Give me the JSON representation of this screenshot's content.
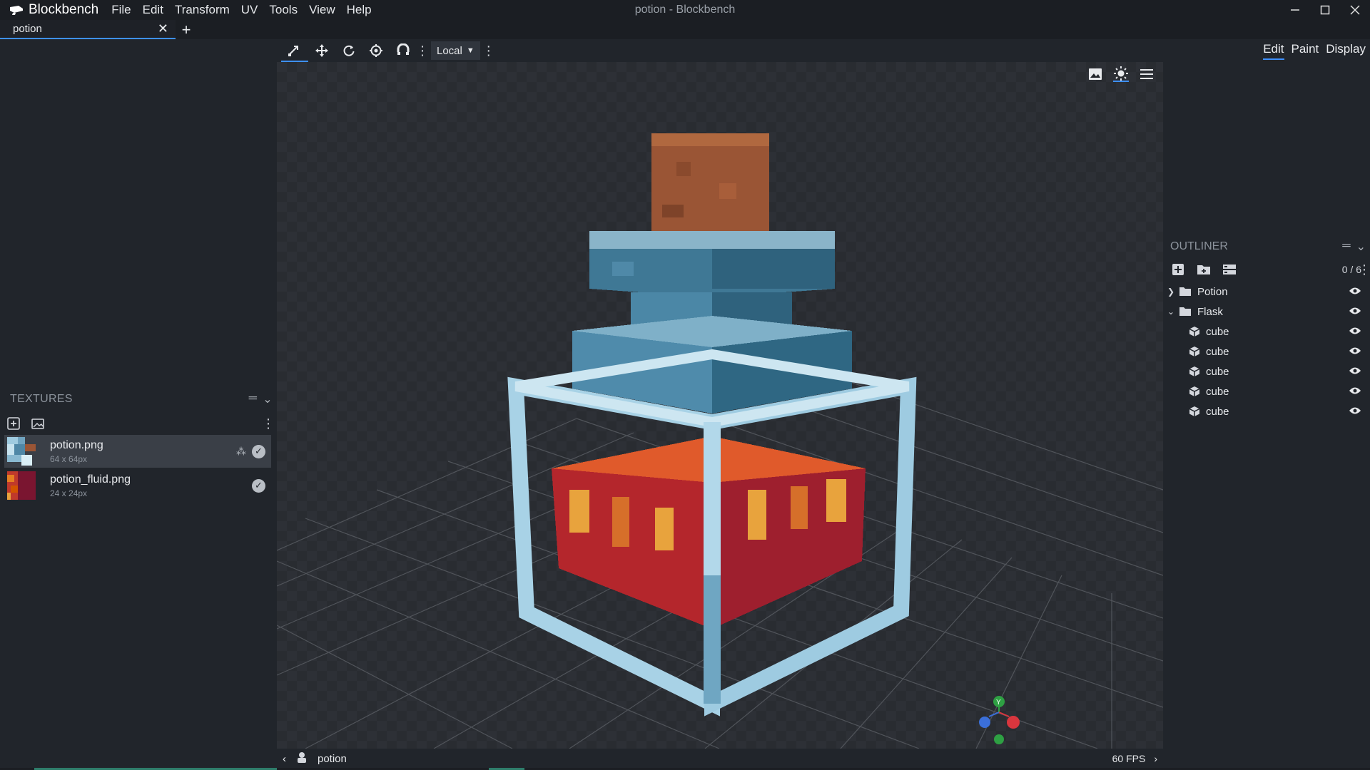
{
  "app": {
    "name": "Blockbench",
    "window_title": "potion - Blockbench",
    "menu": [
      "File",
      "Edit",
      "Transform",
      "UV",
      "Tools",
      "View",
      "Help"
    ]
  },
  "tabs": [
    {
      "label": "potion"
    }
  ],
  "viewport_toolbar": {
    "space_select": "Local"
  },
  "mode_tabs": [
    "Edit",
    "Paint",
    "Display"
  ],
  "textures": {
    "header": "TEXTURES",
    "items": [
      {
        "name": "potion.png",
        "size": "64 x 64px"
      },
      {
        "name": "potion_fluid.png",
        "size": "24 x 24px"
      }
    ]
  },
  "outliner": {
    "header": "OUTLINER",
    "count": "0 / 6",
    "items": [
      {
        "label": "Potion",
        "type": "group",
        "expanded": false,
        "depth": 0
      },
      {
        "label": "Flask",
        "type": "group",
        "expanded": true,
        "depth": 0
      },
      {
        "label": "cube",
        "type": "cube",
        "depth": 1
      },
      {
        "label": "cube",
        "type": "cube",
        "depth": 1
      },
      {
        "label": "cube",
        "type": "cube",
        "depth": 1
      },
      {
        "label": "cube",
        "type": "cube",
        "depth": 1
      },
      {
        "label": "cube",
        "type": "cube",
        "depth": 1
      }
    ]
  },
  "statusbar": {
    "model_name": "potion",
    "fps": "60 FPS"
  },
  "axis_labels": {
    "y": "Y"
  },
  "colors": {
    "accent": "#3e90ff",
    "glass": "#9fcbe0",
    "liquid": "#c0392b",
    "cork": "#9a5535"
  }
}
